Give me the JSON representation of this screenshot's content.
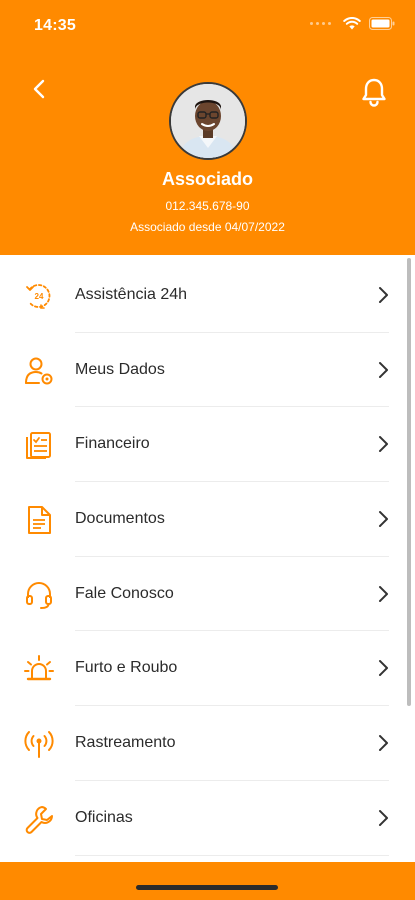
{
  "status_bar": {
    "time": "14:35"
  },
  "profile": {
    "name": "Associado",
    "document": "012.345.678-90",
    "member_since": "Associado desde 04/07/2022"
  },
  "theme": {
    "accent": "#FF8A00"
  },
  "menu": [
    {
      "label": "Assistência 24h",
      "icon": "24h-assistance-icon"
    },
    {
      "label": "Meus Dados",
      "icon": "user-settings-icon"
    },
    {
      "label": "Financeiro",
      "icon": "invoice-icon"
    },
    {
      "label": "Documentos",
      "icon": "document-icon"
    },
    {
      "label": "Fale Conosco",
      "icon": "headset-icon"
    },
    {
      "label": "Furto e Roubo",
      "icon": "alarm-siren-icon"
    },
    {
      "label": "Rastreamento",
      "icon": "tracking-antenna-icon"
    },
    {
      "label": "Oficinas",
      "icon": "wrench-icon"
    }
  ]
}
